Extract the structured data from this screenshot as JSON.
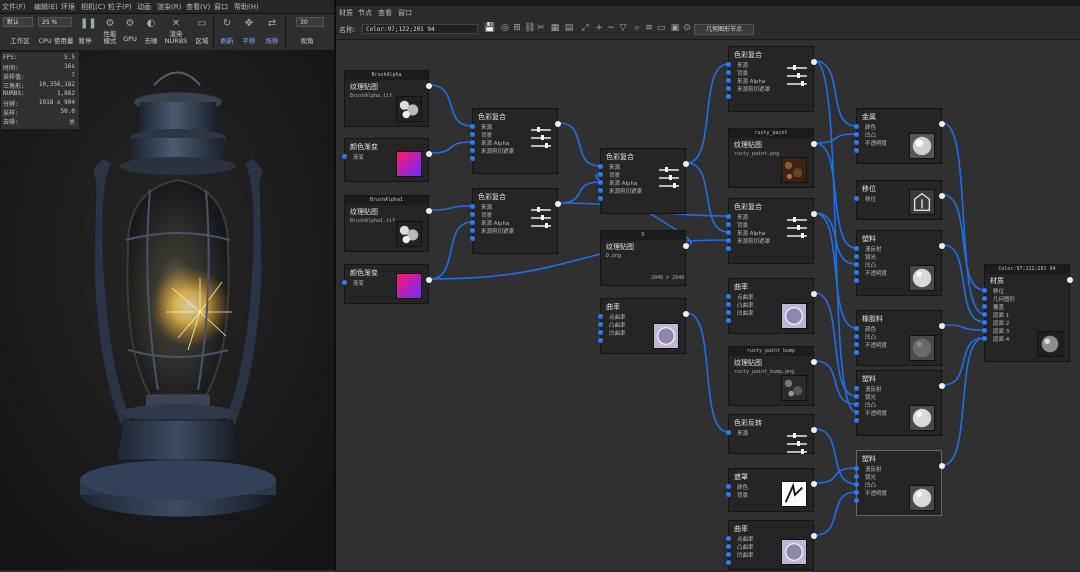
{
  "left": {
    "menu": [
      "文件(F)",
      "编辑(E)",
      "环境",
      "相机(C)",
      "粒子(P)",
      "动画",
      "渲染(R)",
      "查看(V)",
      "窗口",
      "帮助(H)"
    ],
    "toolbar": {
      "preset_value": "默认",
      "mode_value": "25 %",
      "fps_value": "30",
      "buttons": [
        {
          "label": "工作区",
          "icon": "workspace-icon"
        },
        {
          "label": "CPU 使用量",
          "icon": "cpu-icon"
        },
        {
          "label": "暂停",
          "icon": "pause-icon"
        },
        {
          "label": "性能\n模式",
          "icon": "performance-icon"
        },
        {
          "label": "GPU",
          "icon": "gpu-icon"
        },
        {
          "label": "去噪",
          "icon": "denoise-icon"
        },
        {
          "label": "渲染\nNURBS",
          "icon": "nurbs-icon"
        },
        {
          "label": "区域",
          "icon": "region-icon"
        },
        {
          "label": "刷新",
          "icon": "refresh-icon"
        },
        {
          "label": "平移",
          "icon": "pan-icon"
        },
        {
          "label": "拖移",
          "icon": "drag-icon"
        },
        {
          "label": "视角",
          "icon": "view-icon"
        }
      ]
    },
    "stats": [
      {
        "k": "FPS:",
        "v": "5.5"
      },
      {
        "k": "时间:",
        "v": "16s"
      },
      {
        "k": "采样值:",
        "v": "7"
      },
      {
        "k": "三角形:",
        "v": "10,356,182"
      },
      {
        "k": "NURBS:",
        "v": "1,862"
      },
      {
        "k": "分辨:",
        "v": "1918 x 904"
      },
      {
        "k": "采样:",
        "v": "50.0"
      },
      {
        "k": "去噪:",
        "v": "关"
      }
    ]
  },
  "right": {
    "menu": [
      "材质",
      "节点",
      "查看",
      "窗口"
    ],
    "toolbar": {
      "name_label": "名称:",
      "name_value": "Color:97;122;201 94",
      "mode_button": "几何图形节点",
      "icons": [
        "save-icon",
        "target-icon",
        "add-node-icon",
        "link-icon",
        "unlink-icon",
        "grid-icon",
        "layout-icon",
        "fit-icon",
        "zoom-in-icon",
        "zoom-out-icon",
        "filter-icon",
        "search-icon",
        "align-icon",
        "collapse-icon",
        "expand-icon",
        "pin-icon"
      ]
    },
    "nodes": {
      "tex1": {
        "header": "BrushAlpha",
        "title": "纹理贴图",
        "sub": "BrushAlpha.tif"
      },
      "grad1": {
        "title": "颜色渐变",
        "port": "渐变"
      },
      "tex2": {
        "header": "BrushAlpha1",
        "title": "纹理贴图",
        "sub": "BrushAlpha1.tif"
      },
      "grad2": {
        "title": "颜色渐变",
        "port": "渐变"
      },
      "mix1": {
        "title": "色彩复合",
        "ports": [
          "来源",
          "背景",
          "来源 Alpha",
          "来源剪切遮罩",
          ""
        ]
      },
      "mix2": {
        "title": "色彩复合",
        "ports": [
          "来源",
          "背景",
          "来源 Alpha",
          "来源剪切遮罩",
          ""
        ]
      },
      "mix3": {
        "title": "色彩复合",
        "ports": [
          "来源",
          "背景",
          "来源 Alpha",
          "来源剪切遮罩",
          ""
        ]
      },
      "texmid": {
        "header": "D",
        "title": "纹理贴图",
        "sub": "D.png",
        "meta": "2048 x 2048"
      },
      "curv1": {
        "title": "曲率",
        "ports": [
          "点曲率",
          "凸曲率",
          "凹曲率",
          ""
        ]
      },
      "mixtop": {
        "title": "色彩复合",
        "ports": [
          "来源",
          "背景",
          "来源 Alpha",
          "来源剪切遮罩",
          ""
        ]
      },
      "texrust": {
        "header": "rusty_paint",
        "title": "纹理贴图",
        "sub": "rusty_paint.png"
      },
      "mix4": {
        "title": "色彩复合",
        "ports": [
          "来源",
          "背景",
          "来源 Alpha",
          "来源剪切遮罩",
          ""
        ]
      },
      "curv2": {
        "title": "曲率",
        "ports": [
          "点曲率",
          "凸曲率",
          "凹曲率",
          ""
        ]
      },
      "texbump": {
        "header": "rusty_paint_bump",
        "title": "纹理贴图",
        "sub": "rusty_paint_bump.png"
      },
      "adjust": {
        "title": "色彩反转",
        "port": "来源"
      },
      "mask": {
        "title": "遮罩",
        "ports": [
          "颜色",
          "背景"
        ]
      },
      "curv3": {
        "title": "曲率",
        "ports": [
          "点曲率",
          "凸曲率",
          "凹曲率",
          ""
        ]
      },
      "metal": {
        "title": "金属",
        "ports": [
          "颜色",
          "凹凸",
          "不透明度",
          ""
        ]
      },
      "offset": {
        "title": "移位",
        "port": "移位"
      },
      "plastic1": {
        "title": "塑料",
        "ports": [
          "漫反射",
          "镜光",
          "凹凸",
          "不透明度",
          ""
        ]
      },
      "rubber": {
        "title": "橡胶料",
        "ports": [
          "颜色",
          "凹凸",
          "不透明度",
          ""
        ]
      },
      "plastic2": {
        "title": "塑料",
        "ports": [
          "漫反射",
          "镜光",
          "凹凸",
          "不透明度",
          ""
        ]
      },
      "plastic3": {
        "title": "塑料",
        "ports": [
          "漫反射",
          "镜光",
          "凹凸",
          "不透明度",
          ""
        ]
      },
      "material": {
        "header": "Color:97;122;201 94",
        "title": "材质",
        "ports": [
          "移位",
          "几何图形",
          "覆盖",
          "层面 1",
          "层面 2",
          "层面 3",
          "层面 4"
        ]
      }
    },
    "colors": {
      "wire": "#1f6fe8",
      "port": "#2a7bff",
      "output": "#f0f0f0",
      "node_bg": "#252525",
      "canvas_bg": "#303030"
    }
  }
}
